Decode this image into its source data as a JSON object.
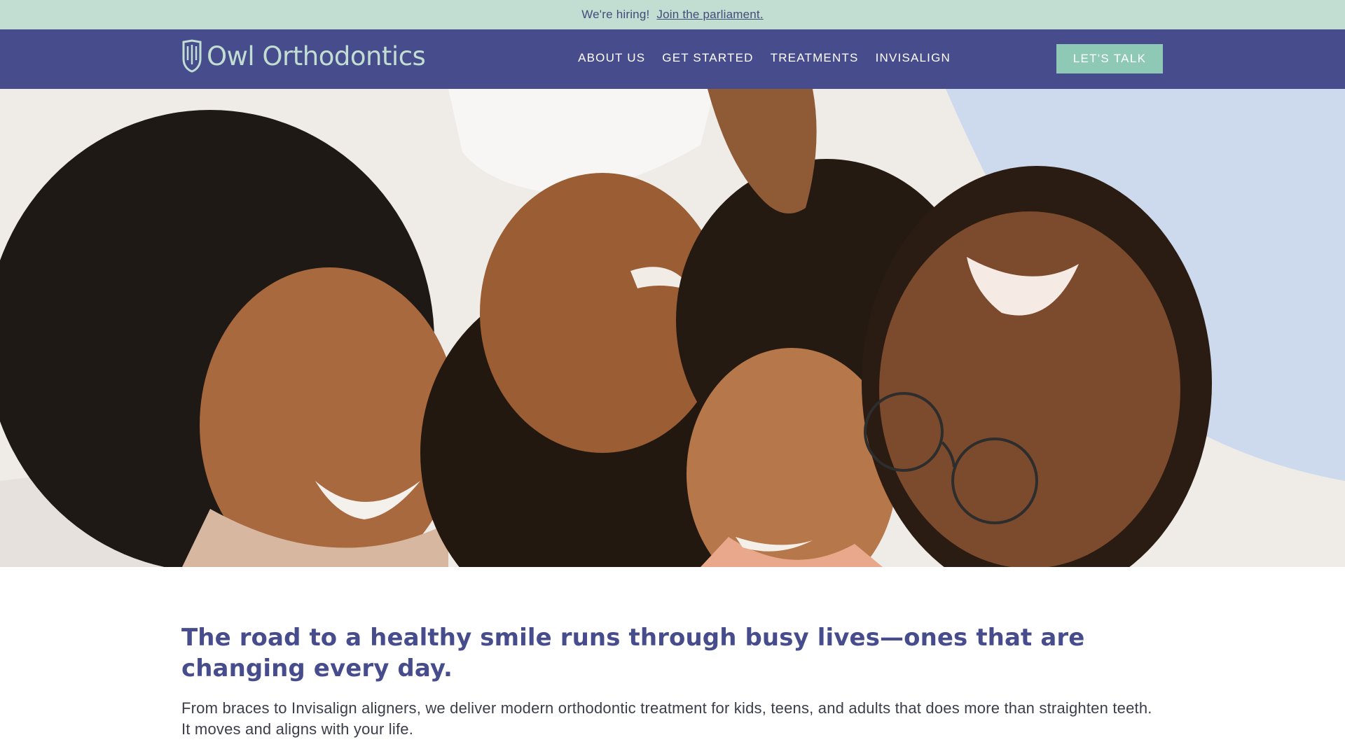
{
  "promo": {
    "text": "We're hiring!",
    "link_label": "Join the parliament."
  },
  "header": {
    "brand": "Owl Orthodontics",
    "nav": [
      {
        "label": "ABOUT US"
      },
      {
        "label": "GET STARTED"
      },
      {
        "label": "TREATMENTS"
      },
      {
        "label": "INVISALIGN"
      }
    ],
    "cta_label": "LET'S TALK"
  },
  "intro": {
    "headline": "The road to a healthy smile runs through busy lives—ones that are changing every day.",
    "body": "From braces to Invisalign aligners, we deliver modern orthodontic treatment for kids, teens, and adults that does more than straighten teeth. It moves and aligns with your life."
  },
  "colors": {
    "promo_bg": "#c2ddd1",
    "header_bg": "#474d8c",
    "accent": "#8ec9b5",
    "headline": "#474d8c"
  },
  "icons": {
    "logo_mark": "owl-shield-icon"
  }
}
